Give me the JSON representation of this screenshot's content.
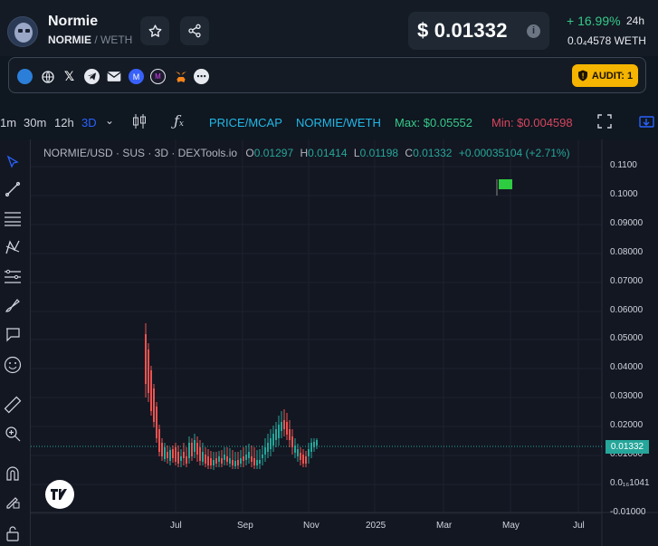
{
  "token": {
    "name": "Normie",
    "symbol": "NORMIE",
    "quote": "/ WETH",
    "price": "$ 0.01332",
    "change": "+ 16.99%",
    "period": "24h",
    "weth_price": "0.0₄4578  WETH"
  },
  "links": {
    "icons": [
      "site-icon",
      "globe-icon",
      "x-icon",
      "telegram-icon",
      "mail-icon",
      "coinmarketcap-icon",
      "coingecko-icon",
      "metamask-icon",
      "more-icon"
    ],
    "audit_label": "AUDIT: 1"
  },
  "toolbar": {
    "intervals": [
      "1m",
      "30m",
      "12h",
      "3D"
    ],
    "active_interval": "3D",
    "price_mcap": "PRICE/MCAP",
    "pair": "NORMIE/WETH",
    "max": "Max: $0.05552",
    "min": "Min: $0.004598"
  },
  "legend": {
    "title": "NORMIE/USD · SUS · 3D · DEXTools.io",
    "o_label": "O",
    "o": "0.01297",
    "h_label": "H",
    "h": "0.01414",
    "l_label": "L",
    "l": "0.01198",
    "c_label": "C",
    "c": "0.01332",
    "delta": "+0.00035104 (+2.71%)"
  },
  "y_axis": [
    "0.1100",
    "0.1000",
    "0.09000",
    "0.08000",
    "0.07000",
    "0.06000",
    "0.05000",
    "0.04000",
    "0.03000",
    "0.02000",
    "0.01000",
    "0.0₁₆1041",
    "-0.01000"
  ],
  "current_price_tag": "0.01332",
  "x_axis": [
    "Jul",
    "Sep",
    "Nov",
    "2025",
    "Mar",
    "May",
    "Jul"
  ],
  "colors": {
    "up": "#26a69a",
    "down": "#ef5350",
    "accent": "#2196f3",
    "audit": "#f5b400"
  }
}
